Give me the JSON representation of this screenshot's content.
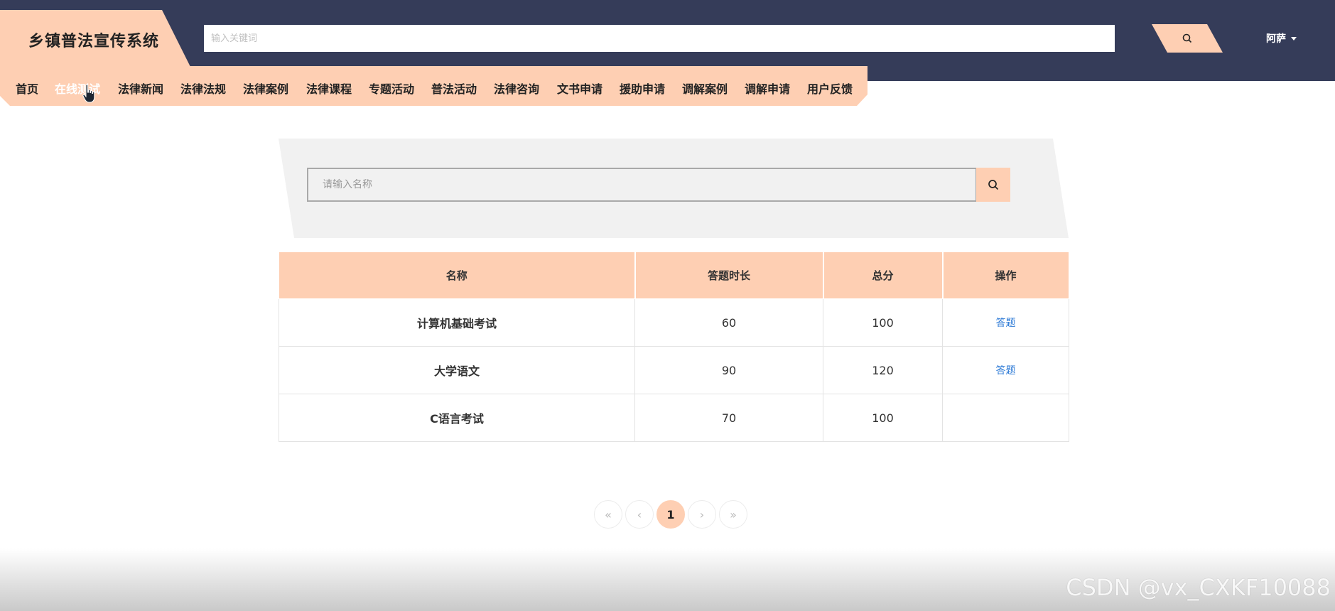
{
  "header": {
    "title": "乡镇普法宣传系统",
    "search_placeholder": "输入关键词",
    "user_name": "阿萨"
  },
  "nav": {
    "items": [
      {
        "label": "首页"
      },
      {
        "label": "在线测试"
      },
      {
        "label": "法律新闻"
      },
      {
        "label": "法律法规"
      },
      {
        "label": "法律案例"
      },
      {
        "label": "法律课程"
      },
      {
        "label": "专题活动"
      },
      {
        "label": "普法活动"
      },
      {
        "label": "法律咨询"
      },
      {
        "label": "文书申请"
      },
      {
        "label": "援助申请"
      },
      {
        "label": "调解案例"
      },
      {
        "label": "调解申请"
      },
      {
        "label": "用户反馈"
      }
    ],
    "active": "在线测试"
  },
  "search": {
    "placeholder": "请输入名称"
  },
  "table": {
    "headers": [
      "名称",
      "答题时长",
      "总分",
      "操作"
    ],
    "rows": [
      {
        "name": "计算机基础考试",
        "duration": "60",
        "score": "100",
        "action": "答题"
      },
      {
        "name": "大学语文",
        "duration": "90",
        "score": "120",
        "action": "答题"
      },
      {
        "name": "C语言考试",
        "duration": "70",
        "score": "100",
        "action": ""
      }
    ]
  },
  "pagination": {
    "first": "«",
    "prev": "‹",
    "current": "1",
    "next": "›",
    "last": "»"
  },
  "watermark": "CSDN @vx_CXKF10088",
  "colors": {
    "accent": "#fecfb3",
    "header_bg": "#353c59",
    "link": "#2d7ad6"
  }
}
